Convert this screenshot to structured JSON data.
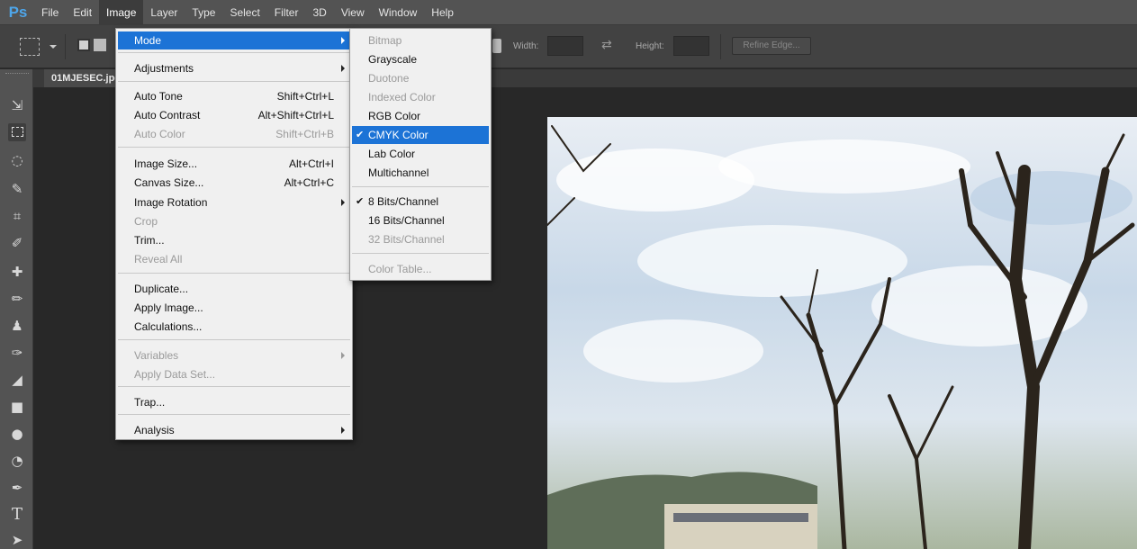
{
  "app": {
    "logo": "Ps"
  },
  "menubar": [
    "File",
    "Edit",
    "Image",
    "Layer",
    "Type",
    "Select",
    "Filter",
    "3D",
    "View",
    "Window",
    "Help"
  ],
  "options": {
    "width_label": "Width:",
    "height_label": "Height:",
    "refine_edge": "Refine Edge..."
  },
  "document": {
    "tab_name": "01MJESEC.jpg"
  },
  "image_menu": [
    {
      "label": "Mode",
      "submenu": true,
      "highlighted": true
    },
    {
      "separator": true
    },
    {
      "label": "Adjustments",
      "submenu": true
    },
    {
      "separator": true
    },
    {
      "label": "Auto Tone",
      "shortcut": "Shift+Ctrl+L"
    },
    {
      "label": "Auto Contrast",
      "shortcut": "Alt+Shift+Ctrl+L"
    },
    {
      "label": "Auto Color",
      "shortcut": "Shift+Ctrl+B",
      "disabled": true
    },
    {
      "separator": true
    },
    {
      "label": "Image Size...",
      "shortcut": "Alt+Ctrl+I"
    },
    {
      "label": "Canvas Size...",
      "shortcut": "Alt+Ctrl+C"
    },
    {
      "label": "Image Rotation",
      "submenu": true
    },
    {
      "label": "Crop",
      "disabled": true
    },
    {
      "label": "Trim..."
    },
    {
      "label": "Reveal All",
      "disabled": true
    },
    {
      "separator": true
    },
    {
      "label": "Duplicate..."
    },
    {
      "label": "Apply Image..."
    },
    {
      "label": "Calculations..."
    },
    {
      "separator": true
    },
    {
      "label": "Variables",
      "submenu": true,
      "disabled": true
    },
    {
      "label": "Apply Data Set...",
      "disabled": true
    },
    {
      "separator": true
    },
    {
      "label": "Trap..."
    },
    {
      "separator": true
    },
    {
      "label": "Analysis",
      "submenu": true
    }
  ],
  "mode_submenu": [
    {
      "label": "Bitmap",
      "disabled": true
    },
    {
      "label": "Grayscale"
    },
    {
      "label": "Duotone",
      "disabled": true
    },
    {
      "label": "Indexed Color",
      "disabled": true
    },
    {
      "label": "RGB Color"
    },
    {
      "label": "CMYK Color",
      "checked": true,
      "highlighted": true
    },
    {
      "label": "Lab Color"
    },
    {
      "label": "Multichannel"
    },
    {
      "separator": true
    },
    {
      "label": "8 Bits/Channel",
      "checked": true
    },
    {
      "label": "16 Bits/Channel"
    },
    {
      "label": "32 Bits/Channel",
      "disabled": true
    },
    {
      "separator": true
    },
    {
      "label": "Color Table...",
      "disabled": true
    }
  ],
  "colors": {
    "accent": "#1c73d6",
    "logo": "#4ea6ea",
    "menubar": "#535353",
    "workspace": "#282828"
  },
  "tools": [
    "move-icon",
    "marquee-icon",
    "lasso-icon",
    "quick-select-icon",
    "crop-icon",
    "eyedropper-icon",
    "healing-brush-icon",
    "brush-icon",
    "clone-stamp-icon",
    "history-brush-icon",
    "eraser-icon",
    "gradient-icon",
    "blur-icon",
    "dodge-icon",
    "pen-icon",
    "type-icon",
    "path-select-icon"
  ]
}
